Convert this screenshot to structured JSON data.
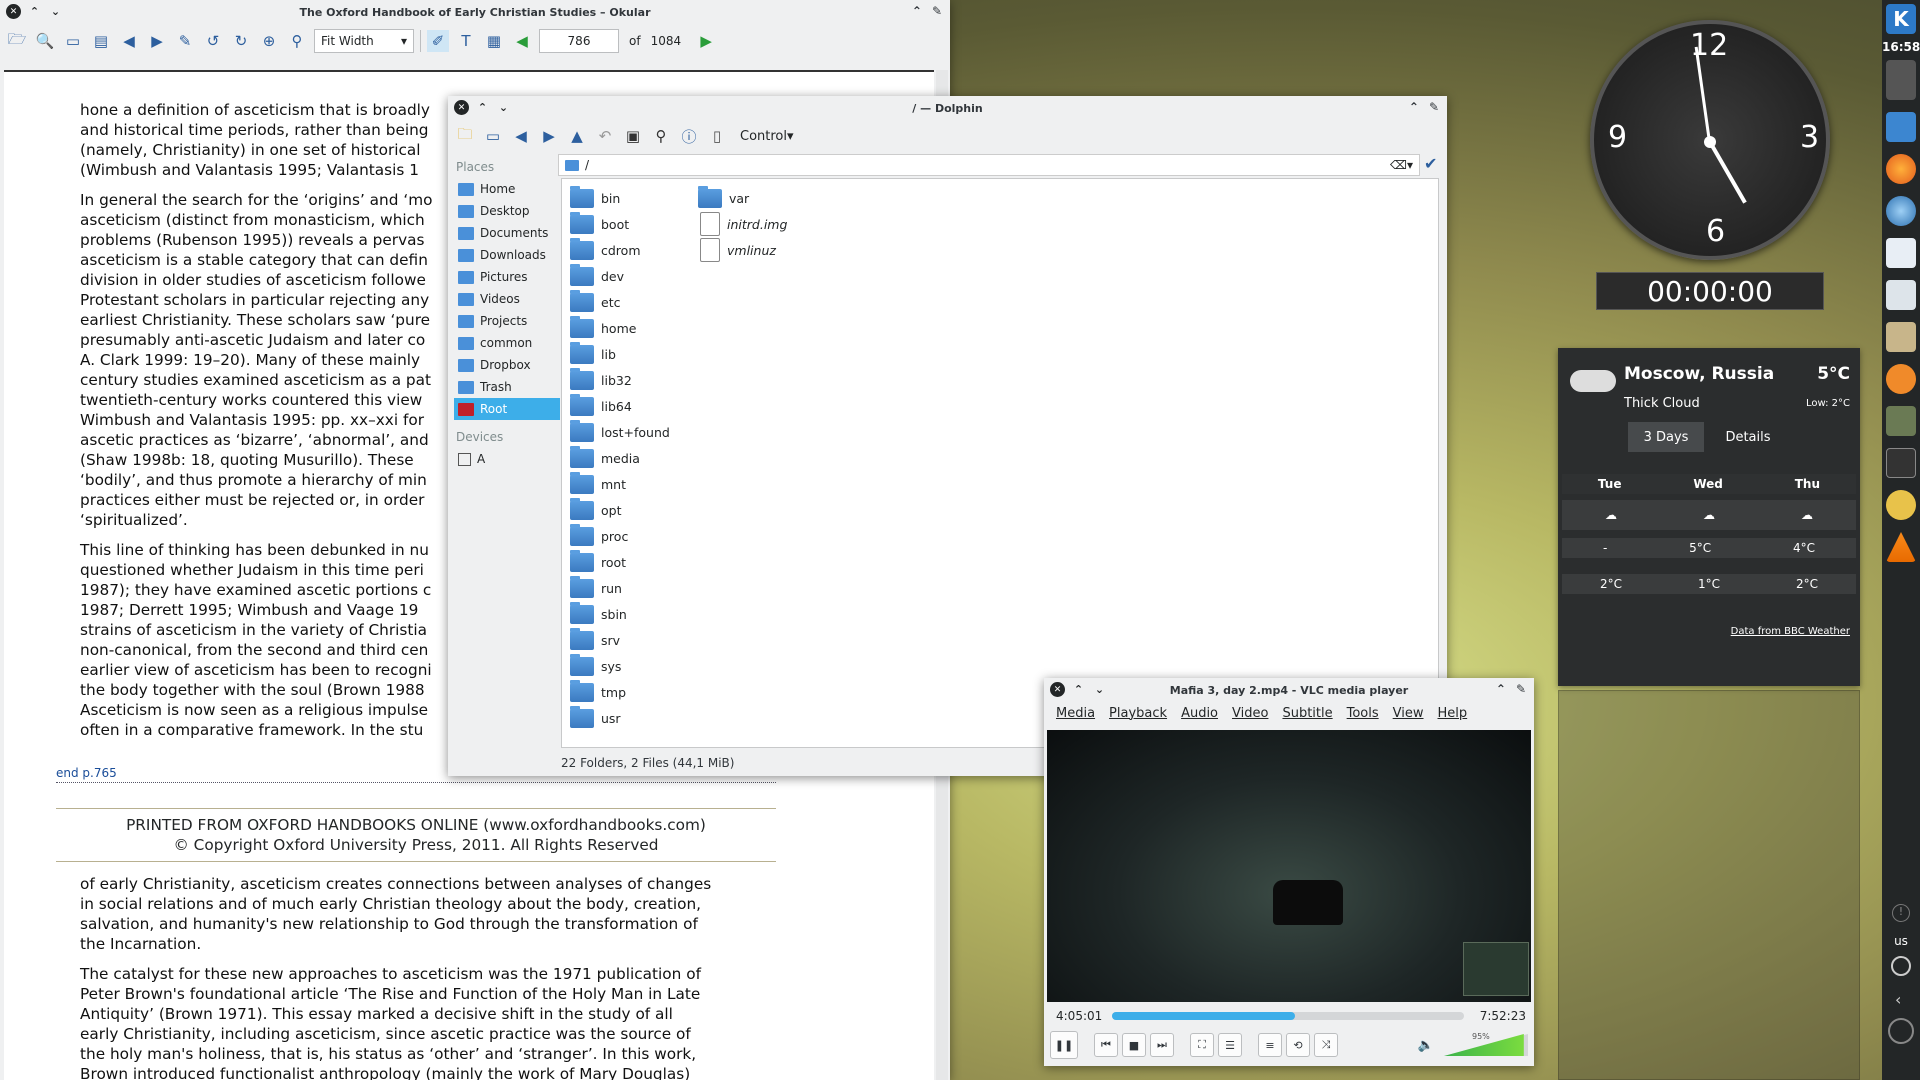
{
  "okular": {
    "title": "The Oxford Handbook of Early Christian Studies – Okular",
    "zoom": "Fit Width",
    "page_current": "786",
    "page_of": "of",
    "page_total": "1084",
    "paragraphs": [
      "hone a definition of asceticism that is broadly\nand historical time periods, rather than being\n(namely, Christianity) in one set of historical\n(Wimbush and Valantasis 1995; Valantasis 1",
      "In general the search for the ‘origins’ and ‘mo\nasceticism (distinct from monasticism, which\nproblems (Rubenson 1995)) reveals a pervas\nasceticism is a stable category that can defin\ndivision in older studies of asceticism followe\nProtestant scholars in particular rejecting any\nearliest Christianity. These scholars saw ‘pure\npresumably anti-ascetic Judaism and later co\nA. Clark 1999: 19–20). Many of these mainly\ncentury studies examined asceticism as a pat\ntwentieth-century works countered this view\nWimbush and Valantasis 1995: pp. xx–xxi for\nascetic practices as ‘bizarre’, ‘abnormal’, and\n(Shaw 1998b: 18, quoting Musurillo). These\n‘bodily’, and thus promote a hierarchy of min\npractices either must be rejected or, in order\n‘spiritualized’.",
      "This line of thinking has been debunked in nu\nquestioned whether Judaism in this time peri\n1987); they have examined ascetic portions c\n1987; Derrett 1995; Wimbush and Vaage 19\nstrains of asceticism in the variety of Christia\nnon-canonical, from the second and third cen\nearlier view of asceticism has been to recogni\nthe body together with the soul (Brown 1988\nAsceticism is now seen as a religious impulse\noften in a comparative framework. In the stu"
    ],
    "page_end": "end p.765",
    "footer1": "PRINTED FROM OXFORD HANDBOOKS ONLINE (www.oxfordhandbooks.com)",
    "footer2": "© Copyright Oxford University Press, 2011. All Rights Reserved",
    "paragraphs2": [
      "of early Christianity, asceticism creates connections between analyses of changes\nin social relations and of much early Christian theology about the body, creation,\nsalvation, and humanity's new relationship to God through the transformation of\nthe Incarnation.",
      "The catalyst for these new approaches to asceticism was the 1971 publication of\nPeter Brown's foundational article ‘The Rise and Function of the Holy Man in Late\nAntiquity’ (Brown 1971). This essay marked a decisive shift in the study of all\nearly Christianity, including asceticism, since ascetic practice was the source of\nthe holy man's holiness, that is, his status as ‘other’ and ‘stranger’. In this work,\nBrown introduced functionalist anthropology (mainly the work of Mary Douglas)"
    ]
  },
  "dolphin": {
    "title": "/ — Dolphin",
    "control": "Control",
    "path": "/",
    "places_header": "Places",
    "places": [
      "Home",
      "Desktop",
      "Documents",
      "Downloads",
      "Pictures",
      "Videos",
      "Projects",
      "common",
      "Dropbox",
      "Trash",
      "Root"
    ],
    "devices_header": "Devices",
    "devices": [
      "A"
    ],
    "col1": [
      "bin",
      "boot",
      "cdrom",
      "dev",
      "etc",
      "home",
      "lib",
      "lib32",
      "lib64",
      "lost+found",
      "media",
      "mnt",
      "opt",
      "proc",
      "root",
      "run",
      "sbin",
      "srv",
      "sys",
      "tmp",
      "usr"
    ],
    "col2_folder": "var",
    "col2_files": [
      "initrd.img",
      "vmlinuz"
    ],
    "status": "22 Folders, 2 Files (44,1 MiB)"
  },
  "vlc": {
    "title": "Mafia 3, day 2.mp4 - VLC media player",
    "menu": [
      "Media",
      "Playback",
      "Audio",
      "Video",
      "Subtitle",
      "Tools",
      "View",
      "Help"
    ],
    "elapsed": "4:05:01",
    "total": "7:52:23",
    "progress": 0.52,
    "volume": "95%",
    "volume_level": 0.95
  },
  "clock": {
    "n12": "12",
    "n3": "3",
    "n6": "6",
    "n9": "9",
    "timer": "00:00:00"
  },
  "weather": {
    "city": "Moscow, Russia",
    "temp": "5°C",
    "condition": "Thick Cloud",
    "low": "Low: 2°C",
    "tab1": "3 Days",
    "tab2": "Details",
    "days": [
      "Tue",
      "Wed",
      "Thu"
    ],
    "row1": [
      "-",
      "5°C",
      "4°C"
    ],
    "row2": [
      "2°C",
      "1°C",
      "2°C"
    ],
    "source": "Data from BBC Weather"
  },
  "panel": {
    "time": "16:58",
    "layout": "us",
    "logo": "K"
  }
}
